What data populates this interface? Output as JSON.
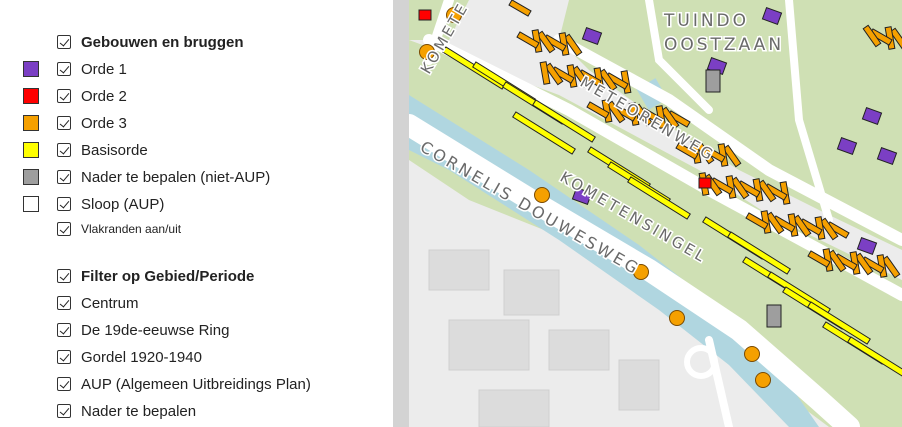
{
  "legend": {
    "group1": {
      "title": "Gebouwen en bruggen",
      "items": [
        {
          "label": "Orde 1",
          "color": "#7b3fc4"
        },
        {
          "label": "Orde 2",
          "color": "#ff0000"
        },
        {
          "label": "Orde 3",
          "color": "#f5a000"
        },
        {
          "label": "Basisorde",
          "color": "#ffff00"
        },
        {
          "label": "Nader te bepalen (niet-AUP)",
          "color": "#9e9e9e"
        },
        {
          "label": "Sloop (AUP)",
          "color": "#ffffff"
        }
      ],
      "outline_toggle": "Vlakranden aan/uit"
    },
    "group2": {
      "title": "Filter op Gebied/Periode",
      "items": [
        {
          "label": "Centrum"
        },
        {
          "label": "De 19de-eeuwse Ring"
        },
        {
          "label": "Gordel 1920-1940"
        },
        {
          "label": "AUP (Algemeen Uitbreidings Plan)"
        },
        {
          "label": "Nader te bepalen"
        }
      ]
    }
  },
  "map": {
    "labels": {
      "area": "TUINDORP OOSTZAAN",
      "area_line1": "TUINDO",
      "area_line2": "OOSTZAAN",
      "meteorenweg": "METEORENWEG",
      "kometensingel": "KOMETENSINGEL",
      "cornelis": "CORNELIS DOUWESWEG",
      "kometen_top": "KOMETE"
    },
    "colors": {
      "background": "#ececec",
      "green": "#cfe0b4",
      "water": "#b0d6e0",
      "road": "#ffffff",
      "orde1": "#7b3fc4",
      "orde2": "#ff0000",
      "orde3": "#f5a000",
      "basisorde": "#ffff00",
      "nader": "#9e9e9e"
    }
  }
}
